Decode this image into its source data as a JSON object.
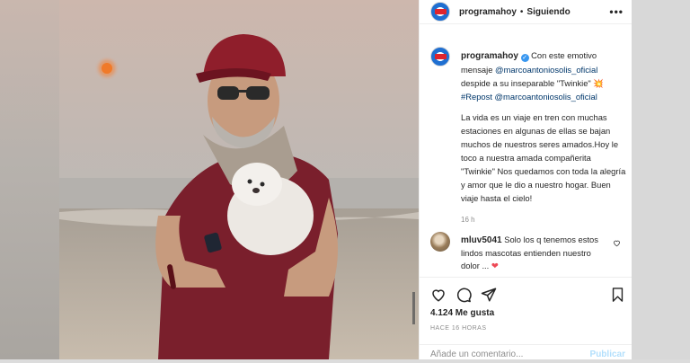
{
  "post": {
    "username": "programahoy",
    "follow_state": "Siguiendo",
    "separator": "•",
    "more_label": "•••"
  },
  "caption": {
    "username": "programahoy",
    "lead": "Con este emotivo mensaje",
    "mention1": "@marcoantoniosolis_oficial",
    "mid": "despide a su inseparable \"Twinkie\"",
    "emoji": "💥",
    "hashtag": "#Repost",
    "mention2": "@marcoantoniosolis_oficial",
    "body": "La vida es un viaje en tren con muchas estaciones en algunas de ellas se bajan muchos de nuestros seres amados.Hoy le toco a nuestra amada compañerita \"Twinkie\" Nos quedamos con toda la alegría y amor que le dio a nuestro hogar. Buen viaje hasta el cielo!",
    "time": "16 h"
  },
  "comment": {
    "username": "mluv5041",
    "text": "Solo los q tenemos estos lindos mascotas entienden nuestro dolor ...",
    "emoji": "❤"
  },
  "stats": {
    "likes": "4.124 Me gusta",
    "ago": "HACE 16 HORAS"
  },
  "composer": {
    "placeholder": "Añade un comentario...",
    "publish": "Publicar"
  },
  "icons": {
    "avatar": "programahoy-logo-icon",
    "verified": "verified-badge-icon",
    "like": "heart-icon",
    "comment": "comment-bubble-icon",
    "share": "paper-plane-icon",
    "save": "bookmark-icon",
    "comment_like": "small-heart-icon"
  },
  "colors": {
    "link": "#00376b",
    "verified": "#3897f0",
    "muted": "#8e8e8e",
    "publish_disabled": "#b2dffc"
  }
}
